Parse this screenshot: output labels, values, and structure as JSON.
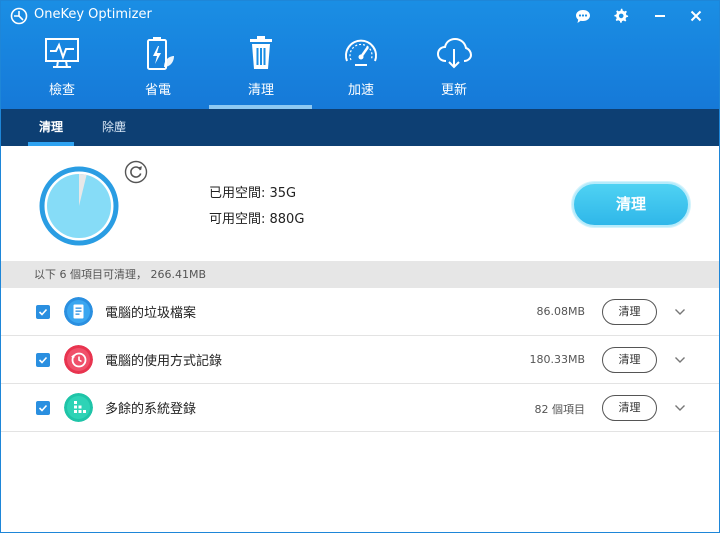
{
  "app": {
    "title": "OneKey Optimizer"
  },
  "nav": {
    "items": [
      {
        "label": "檢查",
        "icon": "monitor-icon"
      },
      {
        "label": "省電",
        "icon": "battery-icon"
      },
      {
        "label": "清理",
        "icon": "trash-icon"
      },
      {
        "label": "加速",
        "icon": "speedometer-icon"
      },
      {
        "label": "更新",
        "icon": "cloud-download-icon"
      }
    ],
    "active_index": 2
  },
  "subtabs": {
    "items": [
      {
        "label": "清理"
      },
      {
        "label": "除塵"
      }
    ],
    "active_index": 0
  },
  "summary": {
    "used_label": "已用空間: 35G",
    "free_label": "可用空間: 880G",
    "used_gb": 35,
    "free_gb": 880,
    "clean_button": "清理"
  },
  "info_bar": {
    "text": "以下 6 個項目可清理， 266.41MB"
  },
  "items": [
    {
      "label": "電腦的垃圾檔案",
      "size": "86.08MB",
      "button": "清理",
      "checked": true,
      "icon": "document-icon",
      "color": "#2a8fe0"
    },
    {
      "label": "電腦的使用方式記錄",
      "size": "180.33MB",
      "button": "清理",
      "checked": true,
      "icon": "history-clock-icon",
      "color": "#e8344f"
    },
    {
      "label": "多餘的系統登錄",
      "size": "82 個項目",
      "button": "清理",
      "checked": true,
      "icon": "registry-icon",
      "color": "#1fc4a8"
    }
  ],
  "colors": {
    "header_blue": "#1a8ee4",
    "subtab_navy": "#0d3f73",
    "accent_cyan": "#2fb7e9"
  }
}
